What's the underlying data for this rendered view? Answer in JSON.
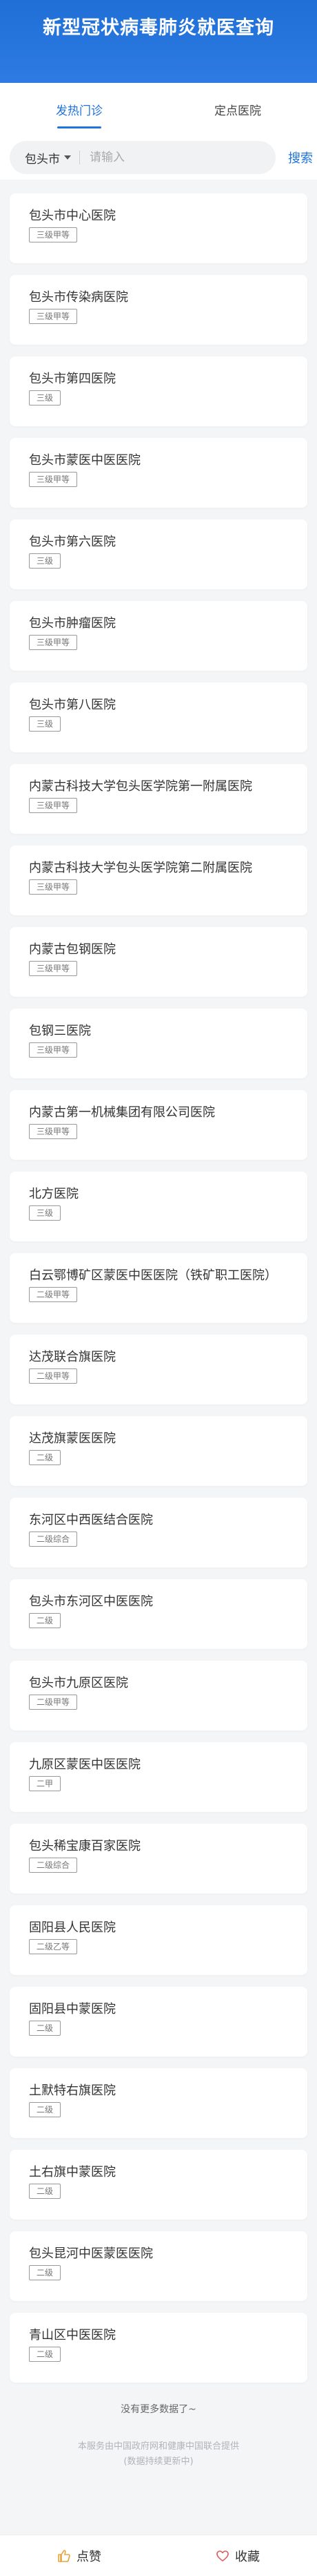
{
  "header": {
    "title": "新型冠状病毒肺炎就医查询"
  },
  "tabs": [
    {
      "label": "发热门诊"
    },
    {
      "label": "定点医院"
    }
  ],
  "search": {
    "city": "包头市",
    "placeholder": "请输入",
    "button_label": "搜索"
  },
  "hospitals": [
    {
      "name": "包头市中心医院",
      "level": "三级甲等"
    },
    {
      "name": "包头市传染病医院",
      "level": "三级甲等"
    },
    {
      "name": "包头市第四医院",
      "level": "三级"
    },
    {
      "name": "包头市蒙医中医医院",
      "level": "三级甲等"
    },
    {
      "name": "包头市第六医院",
      "level": "三级"
    },
    {
      "name": "包头市肿瘤医院",
      "level": "三级甲等"
    },
    {
      "name": "包头市第八医院",
      "level": "三级"
    },
    {
      "name": "内蒙古科技大学包头医学院第一附属医院",
      "level": "三级甲等"
    },
    {
      "name": "内蒙古科技大学包头医学院第二附属医院",
      "level": "三级甲等"
    },
    {
      "name": "内蒙古包钢医院",
      "level": "三级甲等"
    },
    {
      "name": "包钢三医院",
      "level": "三级甲等"
    },
    {
      "name": "内蒙古第一机械集团有限公司医院",
      "level": "三级甲等"
    },
    {
      "name": "北方医院",
      "level": "三级"
    },
    {
      "name": "白云鄂博矿区蒙医中医医院（铁矿职工医院）",
      "level": "二级甲等"
    },
    {
      "name": "达茂联合旗医院",
      "level": "二级甲等"
    },
    {
      "name": "达茂旗蒙医医院",
      "level": "二级"
    },
    {
      "name": "东河区中西医结合医院",
      "level": "二级综合"
    },
    {
      "name": "包头市东河区中医医院",
      "level": "二级"
    },
    {
      "name": "包头市九原区医院",
      "level": "二级甲等"
    },
    {
      "name": "九原区蒙医中医医院",
      "level": "二甲"
    },
    {
      "name": "包头稀宝康百家医院",
      "level": "二级综合"
    },
    {
      "name": "固阳县人民医院",
      "level": "二级乙等"
    },
    {
      "name": "固阳县中蒙医院",
      "level": "二级"
    },
    {
      "name": "土默特右旗医院",
      "level": "二级"
    },
    {
      "name": "土右旗中蒙医院",
      "level": "二级"
    },
    {
      "name": "包头昆河中医蒙医医院",
      "level": "二级"
    },
    {
      "name": "青山区中医医院",
      "level": "二级"
    }
  ],
  "list_end_text": "没有更多数据了~",
  "source_text": [
    "本服务由中国政府网和健康中国联合提供",
    "(数据持续更新中)"
  ],
  "footer": {
    "like_label": "点赞",
    "favorite_label": "收藏"
  },
  "colors": {
    "brand_blue": "#1e73de",
    "header_bg": "#2d7be3",
    "like_icon": "#e8a33a",
    "favorite_icon": "#e05a5a"
  },
  "icons": [
    "caret-down-icon",
    "thumbs-up-icon",
    "heart-icon"
  ]
}
